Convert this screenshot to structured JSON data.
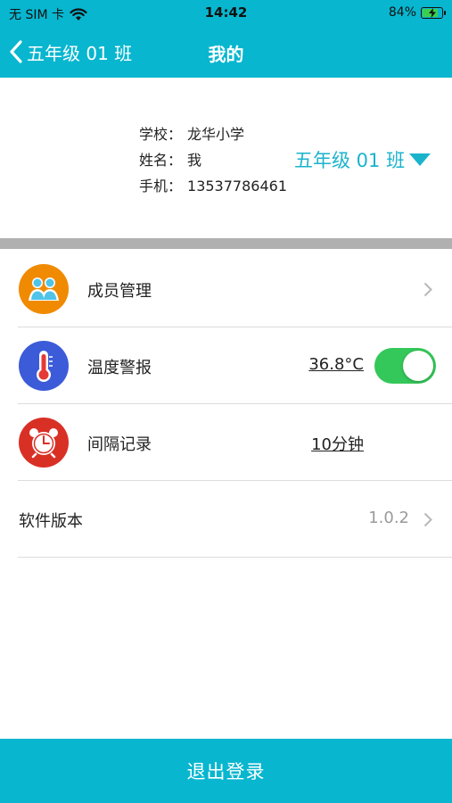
{
  "status_bar": {
    "carrier": "无 SIM 卡",
    "time": "14:42",
    "battery_percent": "84%",
    "battery_level": 0.84
  },
  "nav": {
    "back_label": "五年级 01 班",
    "title": "我的"
  },
  "profile": {
    "school_label": "学校：",
    "school_value": "龙华小学",
    "name_label": "姓名：",
    "name_value": "我",
    "phone_label": "手机：",
    "phone_value": "13537786461",
    "class_selector": "五年级 01 班"
  },
  "menu": {
    "members": {
      "label": "成员管理",
      "icon": "members-icon"
    },
    "temperature": {
      "label": "温度警报",
      "value": "36.8°C",
      "toggle_on": true,
      "icon": "thermometer-icon"
    },
    "interval": {
      "label": "间隔记录",
      "value": "10分钟",
      "icon": "alarm-clock-icon"
    },
    "version": {
      "label": "软件版本",
      "value": "1.0.2"
    }
  },
  "logout_label": "退出登录",
  "colors": {
    "accent": "#08b6cf",
    "members_icon_bg": "#f08a00",
    "temp_icon_bg": "#3b5bd9",
    "interval_icon_bg": "#d93025",
    "toggle_on": "#34c759"
  }
}
